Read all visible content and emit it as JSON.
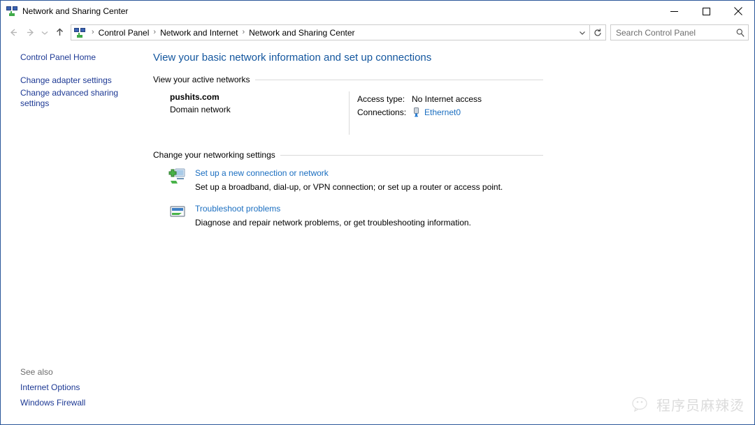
{
  "window": {
    "title": "Network and Sharing Center",
    "icon": "network-icon",
    "controls": {
      "minimize": "Minimize",
      "maximize": "Maximize",
      "close": "Close"
    }
  },
  "toolbar": {
    "back": "Back",
    "forward": "Forward",
    "recent": "Recent locations",
    "up": "Up one level",
    "breadcrumb": [
      "Control Panel",
      "Network and Internet",
      "Network and Sharing Center"
    ],
    "breadcrumb_separator": "›",
    "dropdown": "Previous locations",
    "refresh": "Refresh",
    "search": {
      "placeholder": "Search Control Panel",
      "value": ""
    }
  },
  "sidebar": {
    "items": [
      {
        "label": "Control Panel Home"
      },
      {
        "label": "Change adapter settings"
      },
      {
        "label": "Change advanced sharing settings"
      }
    ],
    "see_also": {
      "title": "See also",
      "items": [
        {
          "label": "Internet Options"
        },
        {
          "label": "Windows Firewall"
        }
      ]
    }
  },
  "main": {
    "heading": "View your basic network information and set up connections",
    "sections": {
      "active_networks": "View your active networks",
      "networking_settings": "Change your networking settings"
    },
    "active_network": {
      "name": "pushits.com",
      "type": "Domain network",
      "access_type_label": "Access type:",
      "access_type_value": "No Internet access",
      "connections_label": "Connections:",
      "connection_name": "Ethernet0"
    },
    "tasks": [
      {
        "icon": "setup-connection-icon",
        "link": "Set up a new connection or network",
        "description": "Set up a broadband, dial-up, or VPN connection; or set up a router or access point."
      },
      {
        "icon": "troubleshoot-icon",
        "link": "Troubleshoot problems",
        "description": "Diagnose and repair network problems, or get troubleshooting information."
      }
    ]
  },
  "watermark": {
    "logo": "wechat-icon",
    "text": "程序员麻辣烫"
  },
  "colors": {
    "heading": "#13569e",
    "link": "#1a6ec0",
    "sidebar_link": "#1d3994",
    "border": "#2b579a"
  }
}
